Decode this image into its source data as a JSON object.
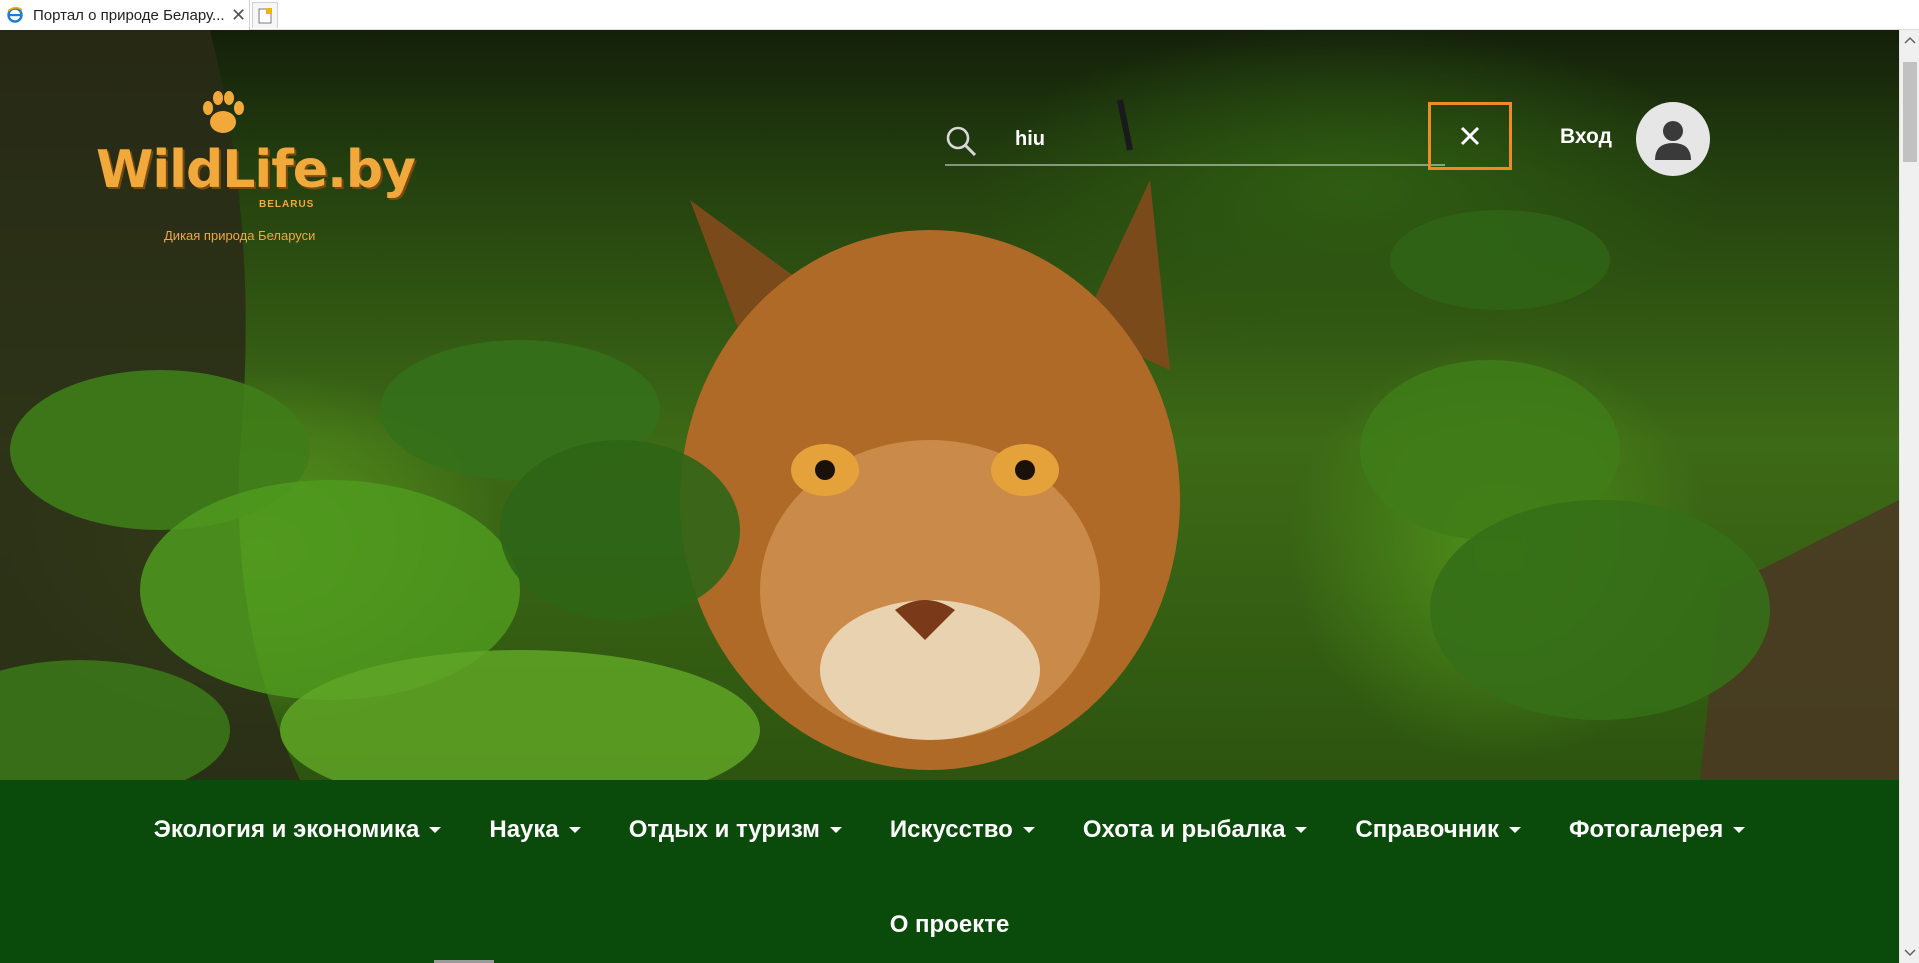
{
  "browser": {
    "tab_title": "Портал о природе Белару...",
    "tab_close": "✕",
    "icons": {
      "tab": "ie-icon",
      "new_tab": "new-tab-icon"
    }
  },
  "header": {
    "logo": {
      "wordmark": "WildLife.by",
      "country": "BELARUS",
      "tagline": "Дикая природа Беларуси",
      "accent": "#f2a93b",
      "icon": "paw-icon"
    },
    "search": {
      "value": "hiu",
      "icon": "search-icon",
      "close_icon": "close-icon",
      "close_border_color": "#f08a24"
    },
    "login_label": "Вход",
    "avatar_icon": "user-icon"
  },
  "nav": {
    "background": "#0a4a0a",
    "items": [
      {
        "label": "Экология и экономика",
        "has_dropdown": true
      },
      {
        "label": "Наука",
        "has_dropdown": true
      },
      {
        "label": "Отдых и туризм",
        "has_dropdown": true
      },
      {
        "label": "Искусство",
        "has_dropdown": true
      },
      {
        "label": "Охота и рыбалка",
        "has_dropdown": true
      },
      {
        "label": "Справочник",
        "has_dropdown": true
      },
      {
        "label": "Фотогалерея",
        "has_dropdown": true
      },
      {
        "label": "О проекте",
        "has_dropdown": false
      }
    ]
  }
}
